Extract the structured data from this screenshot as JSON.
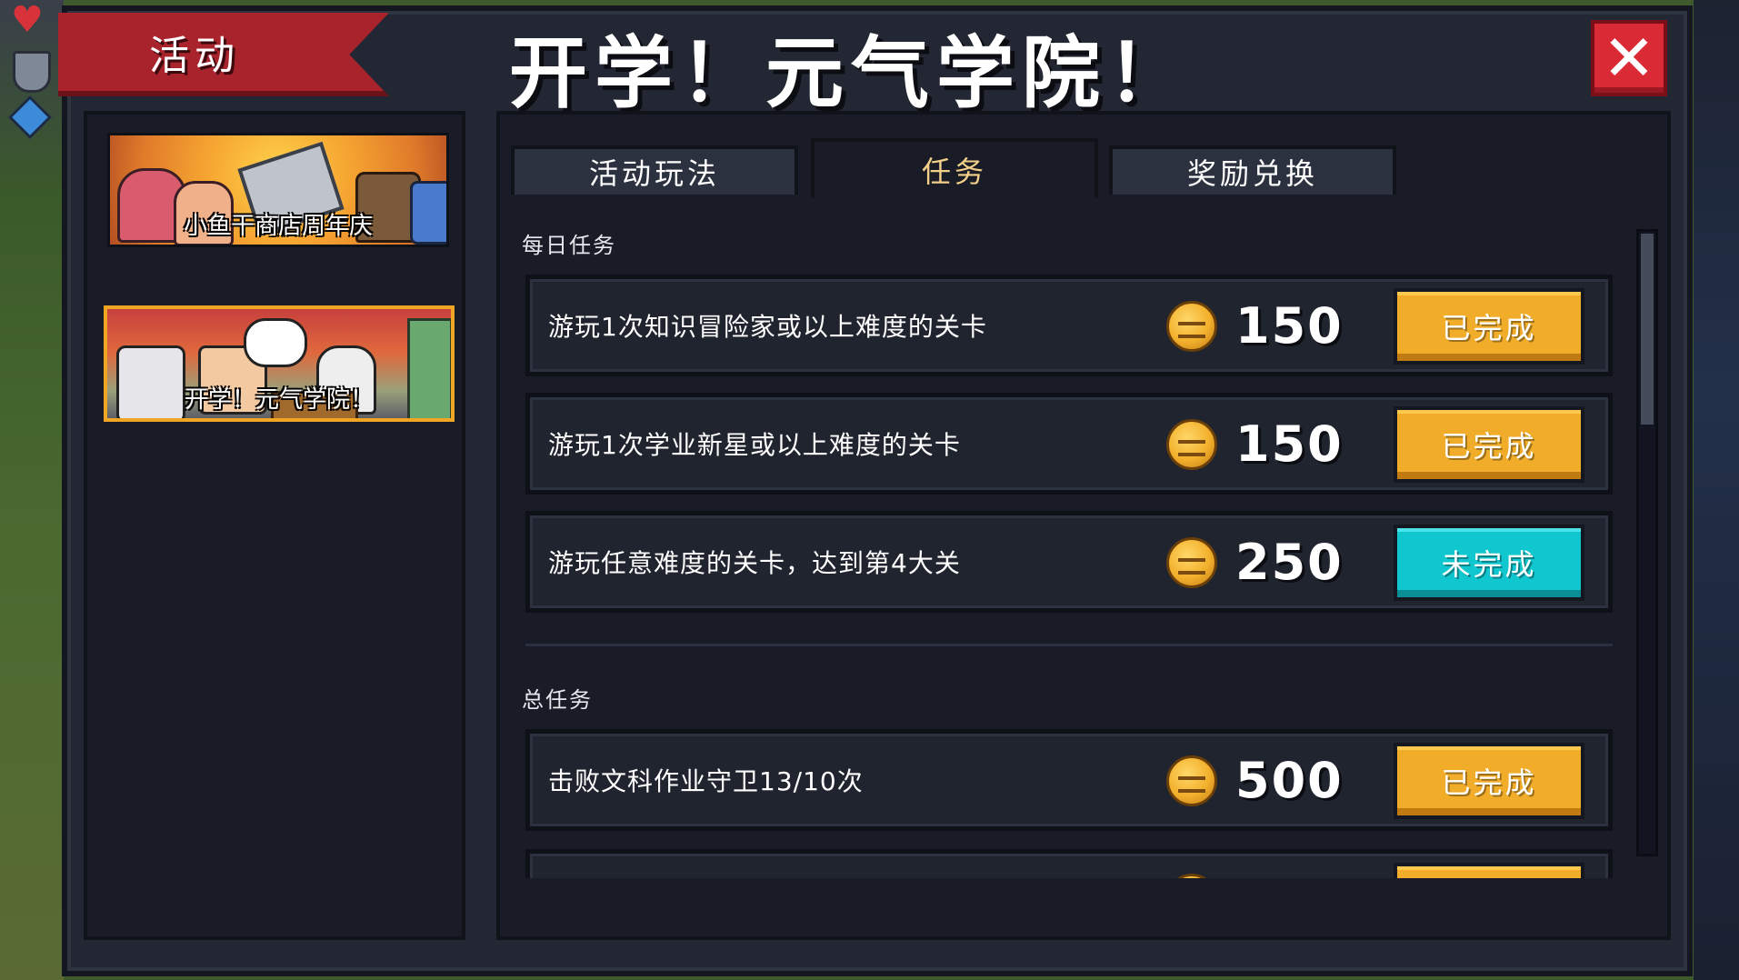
{
  "header": {
    "ribbon_label": "活动",
    "title": "开学！元气学院！",
    "close_symbol": "✕"
  },
  "events": [
    {
      "label": "小鱼干商店周年庆",
      "selected": false
    },
    {
      "label": "开学！元气学院！",
      "selected": true
    }
  ],
  "tabs": [
    {
      "label": "活动玩法",
      "active": false
    },
    {
      "label": "任务",
      "active": true
    },
    {
      "label": "奖励兑换",
      "active": false
    }
  ],
  "sections": {
    "daily_title": "每日任务",
    "total_title": "总任务"
  },
  "daily_tasks": [
    {
      "text": "游玩1次知识冒险家或以上难度的关卡",
      "reward": "150",
      "status": "已完成",
      "state": "done"
    },
    {
      "text": "游玩1次学业新星或以上难度的关卡",
      "reward": "150",
      "status": "已完成",
      "state": "done"
    },
    {
      "text": "游玩任意难度的关卡，达到第4大关",
      "reward": "250",
      "status": "未完成",
      "state": "todo"
    }
  ],
  "total_tasks": [
    {
      "text": "击败文科作业守卫13/10次",
      "reward": "500",
      "status": "已完成",
      "state": "done"
    }
  ],
  "icons": {
    "reward_icon": "gold-coin-icon",
    "close_icon": "close-icon"
  },
  "colors": {
    "done": "#f1ad2a",
    "todo": "#11c7cf",
    "ribbon": "#a9232c",
    "close": "#d92a36"
  },
  "scroll": {
    "position_fraction": 0.0
  }
}
